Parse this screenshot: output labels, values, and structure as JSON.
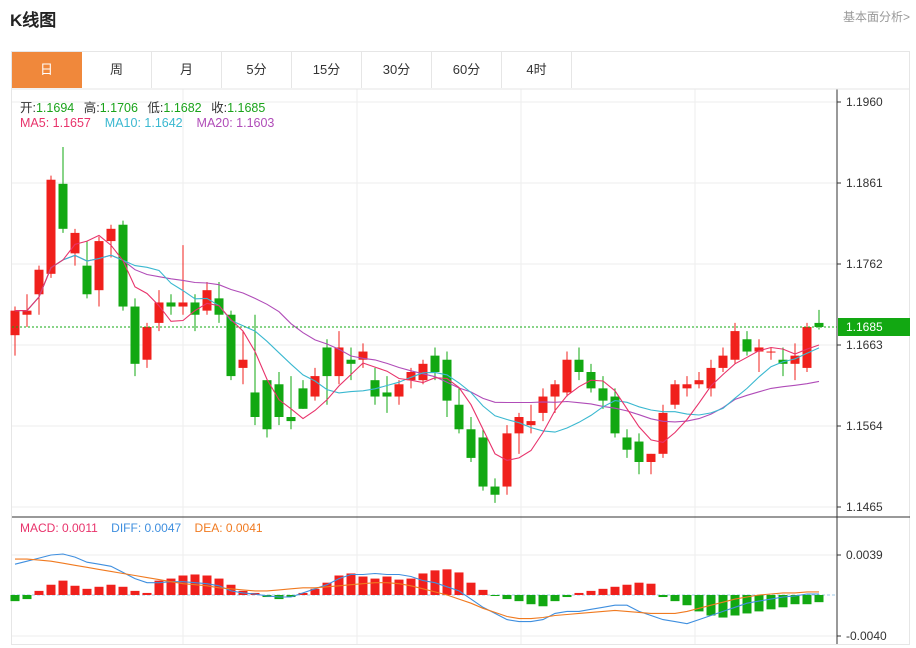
{
  "header": {
    "title": "K线图",
    "more_link": "基本面分析>"
  },
  "tabs": [
    {
      "label": "日",
      "active": true
    },
    {
      "label": "周",
      "active": false
    },
    {
      "label": "月",
      "active": false
    },
    {
      "label": "5分",
      "active": false
    },
    {
      "label": "15分",
      "active": false
    },
    {
      "label": "30分",
      "active": false
    },
    {
      "label": "60分",
      "active": false
    },
    {
      "label": "4时",
      "active": false
    }
  ],
  "ohlc": {
    "open_label": "开:",
    "open": "1.1694",
    "high_label": "高:",
    "high": "1.1706",
    "low_label": "低:",
    "low": "1.1682",
    "close_label": "收:",
    "close": "1.1685"
  },
  "ma": {
    "ma5_label": "MA5: ",
    "ma5": "1.1657",
    "ma10_label": "MA10: ",
    "ma10": "1.1642",
    "ma20_label": "MA20: ",
    "ma20": "1.1603"
  },
  "macd": {
    "macd_label": "MACD: ",
    "macd": "0.0011",
    "diff_label": "DIFF: ",
    "diff": "0.0047",
    "dea_label": "DEA: ",
    "dea": "0.0041"
  },
  "colors": {
    "up": "#f0201c",
    "down": "#12a812",
    "ma5": "#e8336b",
    "ma10": "#3ab8d0",
    "ma20": "#b04cb8",
    "diff": "#3f8fdf",
    "dea": "#f07a20",
    "current": "#12a812",
    "grid": "#eeeeee",
    "accent": "#f0883b"
  },
  "chart_data": [
    {
      "type": "candlestick",
      "ylim": [
        1.1465,
        1.196
      ],
      "yticks": [
        "1.1960",
        "1.1861",
        "1.1762",
        "1.1663",
        "1.1564",
        "1.1465"
      ],
      "current_price": "1.1685",
      "candles": [
        [
          1.1675,
          1.171,
          1.165,
          1.1705
        ],
        [
          1.17,
          1.1725,
          1.1685,
          1.1705
        ],
        [
          1.1725,
          1.176,
          1.17,
          1.1755
        ],
        [
          1.175,
          1.187,
          1.1745,
          1.1865
        ],
        [
          1.186,
          1.1905,
          1.18,
          1.1805
        ],
        [
          1.1775,
          1.1805,
          1.176,
          1.18
        ],
        [
          1.176,
          1.179,
          1.172,
          1.1725
        ],
        [
          1.173,
          1.1795,
          1.171,
          1.179
        ],
        [
          1.179,
          1.181,
          1.177,
          1.1805
        ],
        [
          1.181,
          1.1815,
          1.1705,
          1.171
        ],
        [
          1.171,
          1.172,
          1.1625,
          1.164
        ],
        [
          1.1645,
          1.169,
          1.1635,
          1.1685
        ],
        [
          1.169,
          1.173,
          1.168,
          1.1715
        ],
        [
          1.1715,
          1.1725,
          1.17,
          1.171
        ],
        [
          1.171,
          1.1785,
          1.17,
          1.1715
        ],
        [
          1.1715,
          1.1725,
          1.168,
          1.17
        ],
        [
          1.1705,
          1.174,
          1.17,
          1.173
        ],
        [
          1.172,
          1.174,
          1.169,
          1.17
        ],
        [
          1.17,
          1.1705,
          1.162,
          1.1625
        ],
        [
          1.1635,
          1.168,
          1.1615,
          1.1645
        ],
        [
          1.1605,
          1.17,
          1.1565,
          1.1575
        ],
        [
          1.162,
          1.162,
          1.155,
          1.156
        ],
        [
          1.1615,
          1.163,
          1.1565,
          1.1575
        ],
        [
          1.1575,
          1.1625,
          1.156,
          1.157
        ],
        [
          1.161,
          1.162,
          1.1585,
          1.1585
        ],
        [
          1.16,
          1.1635,
          1.1595,
          1.1625
        ],
        [
          1.166,
          1.167,
          1.159,
          1.1625
        ],
        [
          1.1625,
          1.168,
          1.1615,
          1.166
        ],
        [
          1.1645,
          1.166,
          1.162,
          1.164
        ],
        [
          1.1645,
          1.1665,
          1.1635,
          1.1655
        ],
        [
          1.162,
          1.1635,
          1.159,
          1.16
        ],
        [
          1.1605,
          1.1625,
          1.158,
          1.16
        ],
        [
          1.16,
          1.162,
          1.159,
          1.1615
        ],
        [
          1.162,
          1.1635,
          1.161,
          1.163
        ],
        [
          1.162,
          1.1645,
          1.1615,
          1.164
        ],
        [
          1.165,
          1.166,
          1.162,
          1.163
        ],
        [
          1.1645,
          1.1655,
          1.1575,
          1.1595
        ],
        [
          1.159,
          1.161,
          1.1555,
          1.156
        ],
        [
          1.156,
          1.1575,
          1.152,
          1.1525
        ],
        [
          1.155,
          1.156,
          1.1485,
          1.149
        ],
        [
          1.149,
          1.15,
          1.147,
          1.148
        ],
        [
          1.149,
          1.1565,
          1.148,
          1.1555
        ],
        [
          1.1555,
          1.158,
          1.153,
          1.1575
        ],
        [
          1.1565,
          1.159,
          1.1555,
          1.157
        ],
        [
          1.158,
          1.161,
          1.157,
          1.16
        ],
        [
          1.16,
          1.162,
          1.158,
          1.1615
        ],
        [
          1.1605,
          1.1655,
          1.16,
          1.1645
        ],
        [
          1.1645,
          1.166,
          1.162,
          1.163
        ],
        [
          1.163,
          1.164,
          1.1605,
          1.161
        ],
        [
          1.161,
          1.1625,
          1.1585,
          1.1595
        ],
        [
          1.16,
          1.161,
          1.155,
          1.1555
        ],
        [
          1.155,
          1.156,
          1.1525,
          1.1535
        ],
        [
          1.1545,
          1.1555,
          1.1505,
          1.152
        ],
        [
          1.152,
          1.153,
          1.1505,
          1.153
        ],
        [
          1.153,
          1.159,
          1.1525,
          1.158
        ],
        [
          1.159,
          1.162,
          1.1585,
          1.1615
        ],
        [
          1.161,
          1.1625,
          1.16,
          1.1615
        ],
        [
          1.1615,
          1.163,
          1.161,
          1.162
        ],
        [
          1.161,
          1.1645,
          1.16,
          1.1635
        ],
        [
          1.1635,
          1.166,
          1.163,
          1.165
        ],
        [
          1.1645,
          1.169,
          1.164,
          1.168
        ],
        [
          1.167,
          1.168,
          1.165,
          1.1655
        ],
        [
          1.1655,
          1.167,
          1.163,
          1.166
        ],
        [
          1.1655,
          1.166,
          1.1645,
          1.1655
        ],
        [
          1.1645,
          1.166,
          1.1625,
          1.164
        ],
        [
          1.164,
          1.1665,
          1.162,
          1.165
        ],
        [
          1.1635,
          1.169,
          1.163,
          1.1685
        ],
        [
          1.169,
          1.1706,
          1.1682,
          1.1685
        ]
      ]
    },
    {
      "type": "bar",
      "ylim": [
        -0.004,
        0.0039
      ],
      "yticks": [
        "0.0039",
        "-0.0040"
      ],
      "macd_hist": [
        -0.0006,
        -0.0004,
        0.0004,
        0.001,
        0.0014,
        0.0009,
        0.0006,
        0.0008,
        0.001,
        0.0008,
        0.0004,
        0.0002,
        0.0014,
        0.0016,
        0.0019,
        0.002,
        0.0019,
        0.0016,
        0.001,
        0.0004,
        0.0002,
        -0.0002,
        -0.0004,
        -0.0002,
        0.0002,
        0.0006,
        0.0012,
        0.0019,
        0.0021,
        0.0018,
        0.0016,
        0.0018,
        0.0015,
        0.0016,
        0.0021,
        0.0024,
        0.0025,
        0.0022,
        0.0012,
        0.0005,
        -0.0001,
        -0.0004,
        -0.0006,
        -0.0009,
        -0.0011,
        -0.0006,
        -0.0002,
        0.0002,
        0.0004,
        0.0006,
        0.0008,
        0.001,
        0.0012,
        0.0011,
        -0.0002,
        -0.0006,
        -0.001,
        -0.0016,
        -0.002,
        -0.0022,
        -0.002,
        -0.0018,
        -0.0016,
        -0.0014,
        -0.0012,
        -0.0009,
        -0.0009,
        -0.0007
      ],
      "diff": [
        0.003,
        0.0033,
        0.0036,
        0.0039,
        0.004,
        0.0037,
        0.0032,
        0.003,
        0.0028,
        0.0022,
        0.0016,
        0.0012,
        0.0012,
        0.0013,
        0.0013,
        0.0012,
        0.0011,
        0.0009,
        0.0004,
        0.0002,
        0.0001,
        -0.0001,
        -0.0002,
        -0.0002,
        0.0002,
        0.0006,
        0.001,
        0.0016,
        0.002,
        0.002,
        0.0021,
        0.002,
        0.002,
        0.0018,
        0.0014,
        0.0012,
        0.0008,
        0.0004,
        -0.0004,
        -0.0012,
        -0.0018,
        -0.0024,
        -0.0026,
        -0.0026,
        -0.0024,
        -0.0018,
        -0.0016,
        -0.0016,
        -0.0014,
        -0.0012,
        -0.001,
        -0.001,
        -0.0016,
        -0.002,
        -0.0024,
        -0.0026,
        -0.0028,
        -0.0024,
        -0.002,
        -0.0016,
        -0.0012,
        -0.0008,
        -0.0006,
        -0.0004,
        -0.0002,
        -0.0001,
        0.0001,
        0.0001
      ],
      "dea": [
        0.0035,
        0.0035,
        0.0034,
        0.0033,
        0.0031,
        0.0029,
        0.0027,
        0.0025,
        0.0023,
        0.0021,
        0.0019,
        0.0017,
        0.0015,
        0.0013,
        0.0011,
        0.001,
        0.0009,
        0.0007,
        0.0006,
        0.0005,
        0.0004,
        0.0004,
        0.0005,
        0.0006,
        0.0007,
        0.0007,
        0.0008,
        0.0009,
        0.001,
        0.0011,
        0.0012,
        0.0012,
        0.0011,
        0.0009,
        0.0006,
        0.0003,
        0.0,
        -0.0004,
        -0.0008,
        -0.0013,
        -0.0017,
        -0.0021,
        -0.0023,
        -0.0023,
        -0.0022,
        -0.002,
        -0.0019,
        -0.0018,
        -0.0017,
        -0.0016,
        -0.0015,
        -0.0016,
        -0.0017,
        -0.0018,
        -0.0018,
        -0.0018,
        -0.0016,
        -0.0013,
        -0.001,
        -0.0007,
        -0.0004,
        -0.0002,
        0.0,
        0.0001,
        0.0002,
        0.0002,
        0.0003,
        0.0003
      ]
    }
  ]
}
